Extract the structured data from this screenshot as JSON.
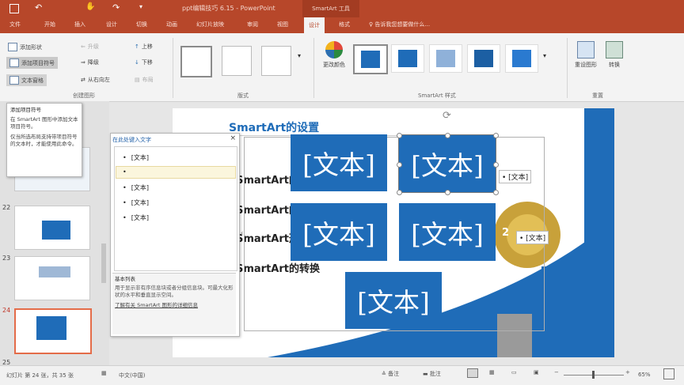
{
  "titlebar": {
    "title": "ppt编辑技巧 6.15 - PowerPoint",
    "context_group": "SmartArt 工具",
    "colors": {
      "accent": "#b7472a",
      "slide_blue": "#1f6cb8",
      "gold": "#c8a13a"
    }
  },
  "tabs": [
    "文件",
    "开始",
    "插入",
    "设计",
    "切换",
    "动画",
    "幻灯片放映",
    "审阅",
    "视图",
    "设计",
    "格式",
    "告诉我您想要做什么..."
  ],
  "active_tab_index": 9,
  "ribbon": {
    "create_graphic": {
      "add_shape": "添加形状",
      "add_bullet": "添加项目符号",
      "text_pane": "文本窗格",
      "promote": "升级",
      "demote": "降级",
      "right_to_left": "从右向左",
      "move_up": "上移",
      "move_down": "下移",
      "layout": "布局",
      "group_label": "创建图形"
    },
    "layouts_label": "版式",
    "change_colors": "更改颜色",
    "styles_label": "SmartArt 样式",
    "reset_graphic": "重设图形",
    "convert": "转换",
    "reset_label": "重置"
  },
  "tooltip": {
    "title": "添加项目符号",
    "line1": "在 SmartArt 图形中添加文本项目符号。",
    "line2": "仅当所选布局支持带项目符号的文本时，才能使用此命令。"
  },
  "slides": [
    {
      "number": "22"
    },
    {
      "number": "23"
    },
    {
      "number": "24",
      "selected": true
    },
    {
      "number": "25"
    }
  ],
  "text_pane": {
    "header": "在此处键入文字",
    "items": [
      "[文本]",
      "",
      "[文本]",
      "[文本]",
      "[文本]"
    ],
    "desc_title": "基本列表",
    "desc_body": "用于显示非有序信息块或者分组信息块。可最大化形状的水平和垂直显示空间。",
    "link": "了解有关 SmartArt 图形的详细信息"
  },
  "slide": {
    "title": "SmartArt的设置",
    "lines": [
      "SmartArt的",
      "SmartArt的",
      "SmartArt形",
      "SmartArt的转换"
    ],
    "boxes": [
      "[文本]",
      "[文本]",
      "[文本]",
      "[文本]",
      "[文本]"
    ],
    "side_labels": [
      "[文本]",
      "[文本]"
    ],
    "gear_number": "2"
  },
  "status": {
    "slide_info": "幻灯片 第 24 张，共 35 张",
    "language": "中文(中国)",
    "notes": "备注",
    "comments": "批注",
    "zoom": "65%"
  }
}
